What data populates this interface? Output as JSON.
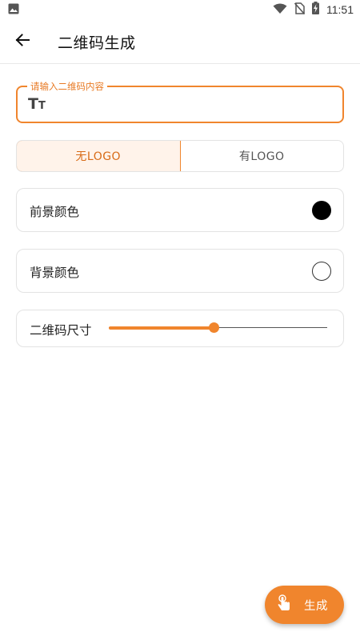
{
  "status_bar": {
    "time": "11:51",
    "icons": [
      "gallery-icon",
      "wifi-icon",
      "no-sim-icon",
      "battery-charging-icon"
    ]
  },
  "app_bar": {
    "title": "二维码生成",
    "back_icon": "arrow-left-icon"
  },
  "content_input": {
    "label": "请输入二维码内容",
    "value": "",
    "icon": "text-size-icon"
  },
  "logo_toggle": {
    "options": [
      "无LOGO",
      "有LOGO"
    ],
    "selected": "无LOGO"
  },
  "foreground_color": {
    "label": "前景颜色",
    "value": "#000000"
  },
  "background_color": {
    "label": "背景颜色",
    "value": "#ffffff"
  },
  "size": {
    "label": "二维码尺寸",
    "value_fraction": 0.48
  },
  "generate_button": {
    "label": "生成",
    "icon": "tap-hand-icon"
  },
  "colors": {
    "accent": "#f0852d",
    "accent_light": "#fff3ea"
  }
}
